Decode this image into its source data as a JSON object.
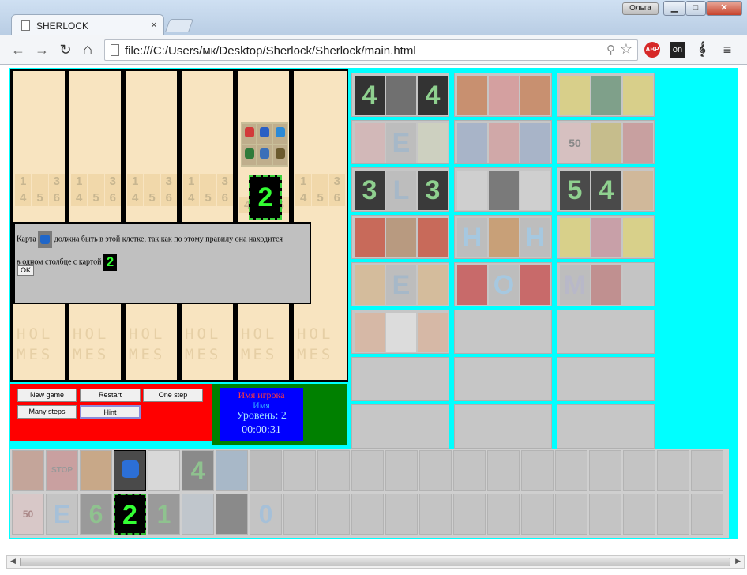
{
  "window": {
    "tab_title": "SHERLOCK",
    "tab_close": "×",
    "user_badge": "Ольга",
    "btn_min": "▁",
    "btn_max": "□",
    "btn_close": "✕"
  },
  "toolbar": {
    "back": "←",
    "forward": "→",
    "reload": "↻",
    "home": "⌂",
    "url": "file:///C:/Users/мк/Desktop/Sherlock/Sherlock/main.html",
    "zoom_icon": "⚲",
    "star_icon": "☆",
    "ext_abp": "ABP",
    "ext_on": "on",
    "ext_clef": "𝄞",
    "menu": "≡"
  },
  "board": {
    "column_numbers": [
      "1",
      "3",
      "4",
      "5",
      "6"
    ],
    "letters_row1": "HOL",
    "letters_row2": "MES",
    "selected_number_card": "2"
  },
  "controls": {
    "new_game": "New game",
    "restart": "Restart",
    "one_step": "One step",
    "many_steps": "Many steps",
    "hint": "Hint"
  },
  "player_info": {
    "player_name_label": "Имя игрока",
    "name": "Имя",
    "level": "Уровень: 2",
    "timer": "00:00:31"
  },
  "dialog": {
    "text_before_card": "Карта",
    "text_after_card": "должна быть в этой клетке, так как по этому правилу она находится",
    "text_line2": "в одном столбце с картой",
    "number_card": "2",
    "ok_label": "OK"
  },
  "ghost_grid": {
    "row1_left": "4",
    "row1_right": "4",
    "row2_letter": "E",
    "row3_left": "3",
    "row3_mid": "L",
    "row3_right": "3",
    "row3_num": "5",
    "row3_num2": "4",
    "row4_h1": "H",
    "row4_h2": "H",
    "row5_e": "E",
    "row5_o": "O",
    "sign_50": "50"
  },
  "bottom_strip": {
    "stop": "STOP",
    "n4": "4",
    "sign_50": "50",
    "e": "E",
    "n6": "6",
    "selected_number": "2",
    "n1": "1",
    "n0": "0"
  },
  "colors": {
    "page_bg": "#00ffff",
    "controls_red": "#ff0000",
    "controls_green": "#008000",
    "info_blue": "#0000ff",
    "number_green": "#33ff33"
  }
}
